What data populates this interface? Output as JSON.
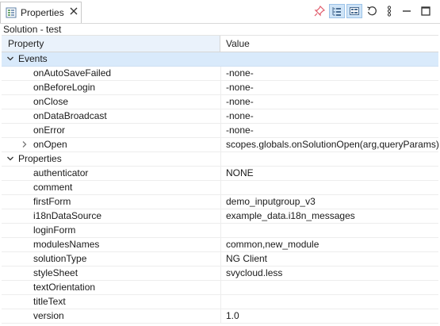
{
  "tab": {
    "label": "Properties",
    "icon": "properties-view-icon"
  },
  "toolbar": {
    "buttons": [
      {
        "name": "pin-icon"
      },
      {
        "name": "show-categories-icon"
      },
      {
        "name": "show-advanced-icon"
      },
      {
        "name": "restore-default-icon"
      },
      {
        "name": "view-menu-icon"
      },
      {
        "name": "minimize-icon"
      },
      {
        "name": "maximize-icon"
      }
    ]
  },
  "subtitle": "Solution - test",
  "table": {
    "columns": {
      "property": "Property",
      "value": "Value"
    },
    "rows": [
      {
        "kind": "category",
        "label": "Events",
        "value": "",
        "expanded": true,
        "selected": true
      },
      {
        "kind": "leaf",
        "label": "onAutoSaveFailed",
        "value": "-none-"
      },
      {
        "kind": "leaf",
        "label": "onBeforeLogin",
        "value": "-none-"
      },
      {
        "kind": "leaf",
        "label": "onClose",
        "value": "-none-"
      },
      {
        "kind": "leaf",
        "label": "onDataBroadcast",
        "value": "-none-"
      },
      {
        "kind": "leaf",
        "label": "onError",
        "value": "-none-"
      },
      {
        "kind": "leaf",
        "label": "onOpen",
        "value": "scopes.globals.onSolutionOpen(arg,queryParams)",
        "expandable": true
      },
      {
        "kind": "category",
        "label": "Properties",
        "value": "",
        "expanded": true
      },
      {
        "kind": "leaf",
        "label": "authenticator",
        "value": "NONE"
      },
      {
        "kind": "leaf",
        "label": "comment",
        "value": ""
      },
      {
        "kind": "leaf",
        "label": "firstForm",
        "value": "demo_inputgroup_v3"
      },
      {
        "kind": "leaf",
        "label": "i18nDataSource",
        "value": "example_data.i18n_messages"
      },
      {
        "kind": "leaf",
        "label": "loginForm",
        "value": ""
      },
      {
        "kind": "leaf",
        "label": "modulesNames",
        "value": "common,new_module"
      },
      {
        "kind": "leaf",
        "label": "solutionType",
        "value": "NG Client"
      },
      {
        "kind": "leaf",
        "label": "styleSheet",
        "value": "svycloud.less"
      },
      {
        "kind": "leaf",
        "label": "textOrientation",
        "value": ""
      },
      {
        "kind": "leaf",
        "label": "titleText",
        "value": ""
      },
      {
        "kind": "leaf",
        "label": "version",
        "value": "1.0"
      }
    ]
  },
  "colors": {
    "selection": "#d9eafb",
    "header_highlight": "#eaf2fb",
    "pin": "#e05a6a",
    "toggle_active": "#cfe4f7"
  }
}
